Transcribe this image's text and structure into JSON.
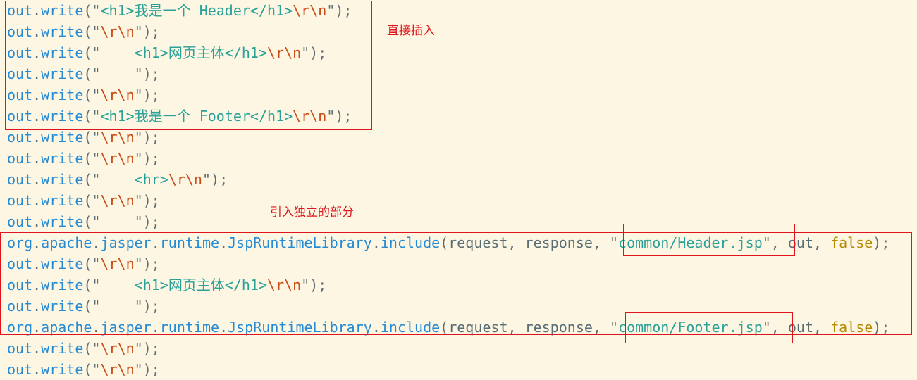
{
  "colors": {
    "background": "#fdf6e3",
    "identifier": "#268bd2",
    "punctuation": "#5f6e74",
    "string": "#2aa198",
    "escape": "#cb4b16",
    "keyword": "#b58900",
    "annotation": "#e0141c"
  },
  "code": {
    "lines": [
      [
        [
          "id",
          "out"
        ],
        [
          "punc",
          "."
        ],
        [
          "id",
          "write"
        ],
        [
          "punc",
          "(\""
        ],
        [
          "str",
          "<h1>我是一个 Header</h1>"
        ],
        [
          "esc",
          "\\r\\n"
        ],
        [
          "punc",
          "\");"
        ]
      ],
      [
        [
          "id",
          "out"
        ],
        [
          "punc",
          "."
        ],
        [
          "id",
          "write"
        ],
        [
          "punc",
          "(\""
        ],
        [
          "esc",
          "\\r\\n"
        ],
        [
          "punc",
          "\");"
        ]
      ],
      [
        [
          "id",
          "out"
        ],
        [
          "punc",
          "."
        ],
        [
          "id",
          "write"
        ],
        [
          "punc",
          "(\""
        ],
        [
          "str",
          "    <h1>网页主体</h1>"
        ],
        [
          "esc",
          "\\r\\n"
        ],
        [
          "punc",
          "\");"
        ]
      ],
      [
        [
          "id",
          "out"
        ],
        [
          "punc",
          "."
        ],
        [
          "id",
          "write"
        ],
        [
          "punc",
          "(\""
        ],
        [
          "str",
          "    "
        ],
        [
          "punc",
          "\");"
        ]
      ],
      [
        [
          "id",
          "out"
        ],
        [
          "punc",
          "."
        ],
        [
          "id",
          "write"
        ],
        [
          "punc",
          "(\""
        ],
        [
          "esc",
          "\\r\\n"
        ],
        [
          "punc",
          "\");"
        ]
      ],
      [
        [
          "id",
          "out"
        ],
        [
          "punc",
          "."
        ],
        [
          "id",
          "write"
        ],
        [
          "punc",
          "(\""
        ],
        [
          "str",
          "<h1>我是一个 Footer</h1>"
        ],
        [
          "esc",
          "\\r\\n"
        ],
        [
          "punc",
          "\");"
        ]
      ],
      [
        [
          "id",
          "out"
        ],
        [
          "punc",
          "."
        ],
        [
          "id",
          "write"
        ],
        [
          "punc",
          "(\""
        ],
        [
          "esc",
          "\\r\\n"
        ],
        [
          "punc",
          "\");"
        ]
      ],
      [
        [
          "id",
          "out"
        ],
        [
          "punc",
          "."
        ],
        [
          "id",
          "write"
        ],
        [
          "punc",
          "(\""
        ],
        [
          "esc",
          "\\r\\n"
        ],
        [
          "punc",
          "\");"
        ]
      ],
      [
        [
          "id",
          "out"
        ],
        [
          "punc",
          "."
        ],
        [
          "id",
          "write"
        ],
        [
          "punc",
          "(\""
        ],
        [
          "str",
          "    <hr>"
        ],
        [
          "esc",
          "\\r\\n"
        ],
        [
          "punc",
          "\");"
        ]
      ],
      [
        [
          "id",
          "out"
        ],
        [
          "punc",
          "."
        ],
        [
          "id",
          "write"
        ],
        [
          "punc",
          "(\""
        ],
        [
          "esc",
          "\\r\\n"
        ],
        [
          "punc",
          "\");"
        ]
      ],
      [
        [
          "id",
          "out"
        ],
        [
          "punc",
          "."
        ],
        [
          "id",
          "write"
        ],
        [
          "punc",
          "(\""
        ],
        [
          "str",
          "    "
        ],
        [
          "punc",
          "\");"
        ]
      ],
      [
        [
          "id",
          "org"
        ],
        [
          "punc",
          "."
        ],
        [
          "id",
          "apache"
        ],
        [
          "punc",
          "."
        ],
        [
          "id",
          "jasper"
        ],
        [
          "punc",
          "."
        ],
        [
          "id",
          "runtime"
        ],
        [
          "punc",
          "."
        ],
        [
          "id",
          "JspRuntimeLibrary"
        ],
        [
          "punc",
          "."
        ],
        [
          "id",
          "include"
        ],
        [
          "punc",
          "("
        ],
        [
          "plain",
          "request, response, "
        ],
        [
          "punc",
          "\""
        ],
        [
          "str",
          "common/Header.jsp"
        ],
        [
          "punc",
          "\""
        ],
        [
          "plain",
          ", out, "
        ],
        [
          "kw",
          "false"
        ],
        [
          "punc",
          ");"
        ]
      ],
      [
        [
          "id",
          "out"
        ],
        [
          "punc",
          "."
        ],
        [
          "id",
          "write"
        ],
        [
          "punc",
          "(\""
        ],
        [
          "esc",
          "\\r\\n"
        ],
        [
          "punc",
          "\");"
        ]
      ],
      [
        [
          "id",
          "out"
        ],
        [
          "punc",
          "."
        ],
        [
          "id",
          "write"
        ],
        [
          "punc",
          "(\""
        ],
        [
          "str",
          "    <h1>网页主体</h1>"
        ],
        [
          "esc",
          "\\r\\n"
        ],
        [
          "punc",
          "\");"
        ]
      ],
      [
        [
          "id",
          "out"
        ],
        [
          "punc",
          "."
        ],
        [
          "id",
          "write"
        ],
        [
          "punc",
          "(\""
        ],
        [
          "str",
          "    "
        ],
        [
          "punc",
          "\");"
        ]
      ],
      [
        [
          "id",
          "org"
        ],
        [
          "punc",
          "."
        ],
        [
          "id",
          "apache"
        ],
        [
          "punc",
          "."
        ],
        [
          "id",
          "jasper"
        ],
        [
          "punc",
          "."
        ],
        [
          "id",
          "runtime"
        ],
        [
          "punc",
          "."
        ],
        [
          "id",
          "JspRuntimeLibrary"
        ],
        [
          "punc",
          "."
        ],
        [
          "id",
          "include"
        ],
        [
          "punc",
          "("
        ],
        [
          "plain",
          "request, response, "
        ],
        [
          "punc",
          "\""
        ],
        [
          "str",
          "common/Footer.jsp"
        ],
        [
          "punc",
          "\""
        ],
        [
          "plain",
          ", out, "
        ],
        [
          "kw",
          "false"
        ],
        [
          "punc",
          ");"
        ]
      ],
      [
        [
          "id",
          "out"
        ],
        [
          "punc",
          "."
        ],
        [
          "id",
          "write"
        ],
        [
          "punc",
          "(\""
        ],
        [
          "esc",
          "\\r\\n"
        ],
        [
          "punc",
          "\");"
        ]
      ],
      [
        [
          "id",
          "out"
        ],
        [
          "punc",
          "."
        ],
        [
          "id",
          "write"
        ],
        [
          "punc",
          "(\""
        ],
        [
          "esc",
          "\\r\\n"
        ],
        [
          "punc",
          "\");"
        ]
      ]
    ]
  },
  "annotations": {
    "direct_insert": "直接插入",
    "include_separate": "引入独立的部分"
  }
}
